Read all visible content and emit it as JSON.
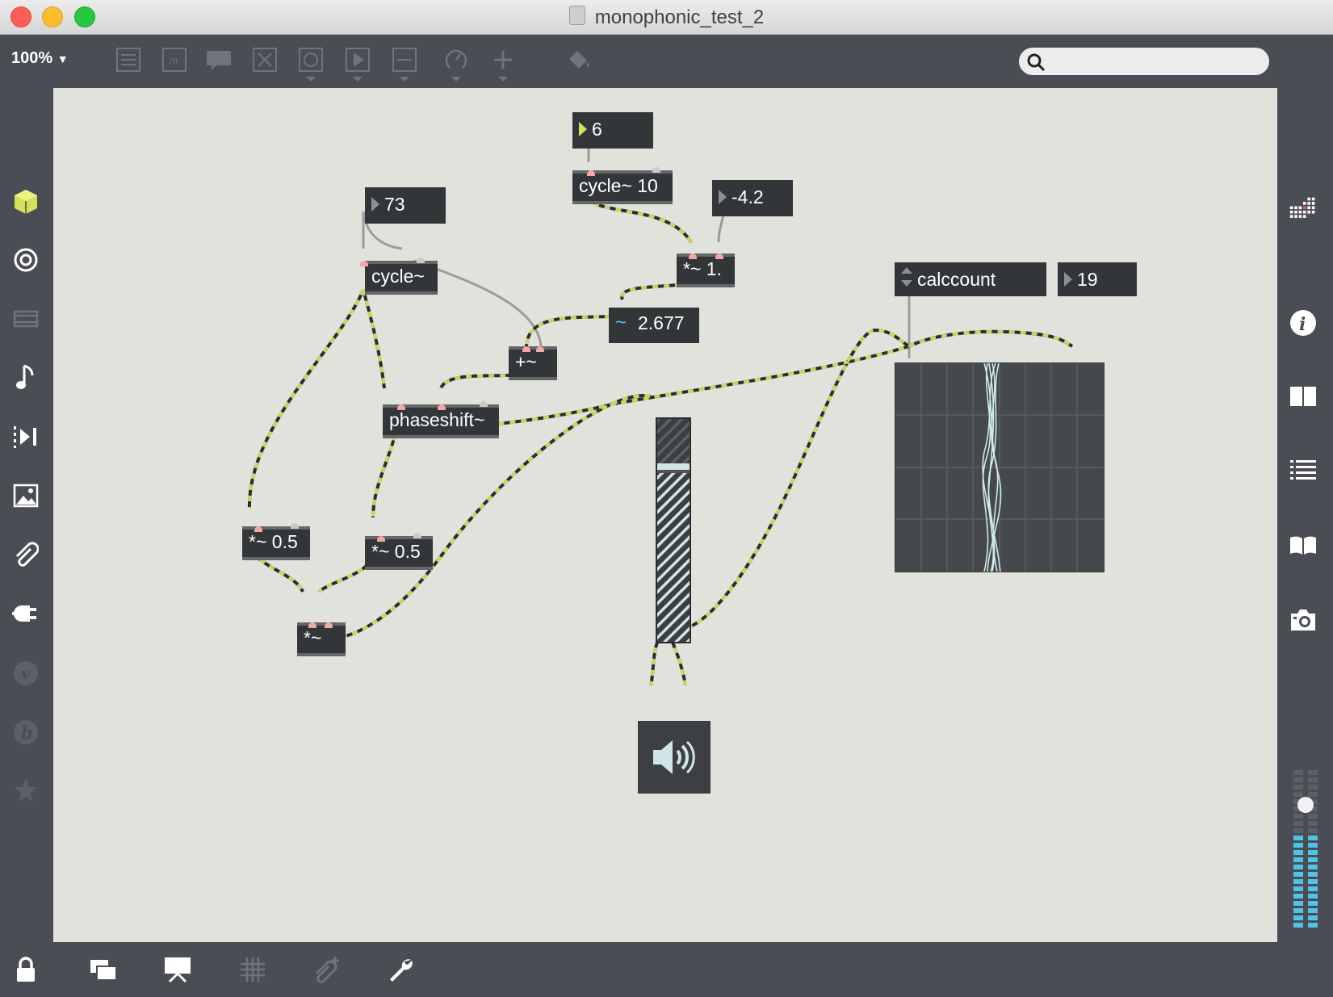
{
  "window": {
    "title": "monophonic_test_2"
  },
  "toolbar": {
    "zoom": "100%",
    "icons": [
      "object-box-icon",
      "message-box-icon",
      "comment-icon",
      "toggle-icon",
      "button-icon",
      "play-icon",
      "slider-icon",
      "dial-icon",
      "plus-icon",
      "paint-bucket-icon"
    ],
    "search_placeholder": "",
    "search_value": ""
  },
  "sidebar_left": [
    "cube-icon",
    "target-icon",
    "filmstrip-icon",
    "music-note-icon",
    "step-play-icon",
    "image-icon",
    "paperclip-icon",
    "plug-icon",
    "vimeo-icon",
    "bandcamp-icon",
    "star-icon"
  ],
  "sidebar_right": [
    "grid-icon",
    "info-icon",
    "split-view-icon",
    "list-icon",
    "book-icon",
    "camera-icon"
  ],
  "bottombar": [
    "lock-icon",
    "windows-icon",
    "presentation-icon",
    "grid-icon",
    "paperclip-add-icon",
    "wrench-icon"
  ],
  "patch": {
    "number_6": "6",
    "number_73": "73",
    "number_neg42": "-4.2",
    "cycle10": "cycle~ 10",
    "cycle": "cycle~",
    "mult1": "*~ 1.",
    "signal_value": "2.677",
    "plus": "+~",
    "phaseshift": "phaseshift~",
    "mult05_a": "*~ 0.5",
    "mult05_b": "*~ 0.5",
    "mult": "*~",
    "attr_name": "calccount",
    "attr_value": "19",
    "gain_level": 0.8
  },
  "colors": {
    "canvas": "#e2e2dc",
    "object": "#333638",
    "signal_cord": "#c8d85a",
    "accent": "#d5e05a",
    "meter": "#4fc3e8"
  }
}
